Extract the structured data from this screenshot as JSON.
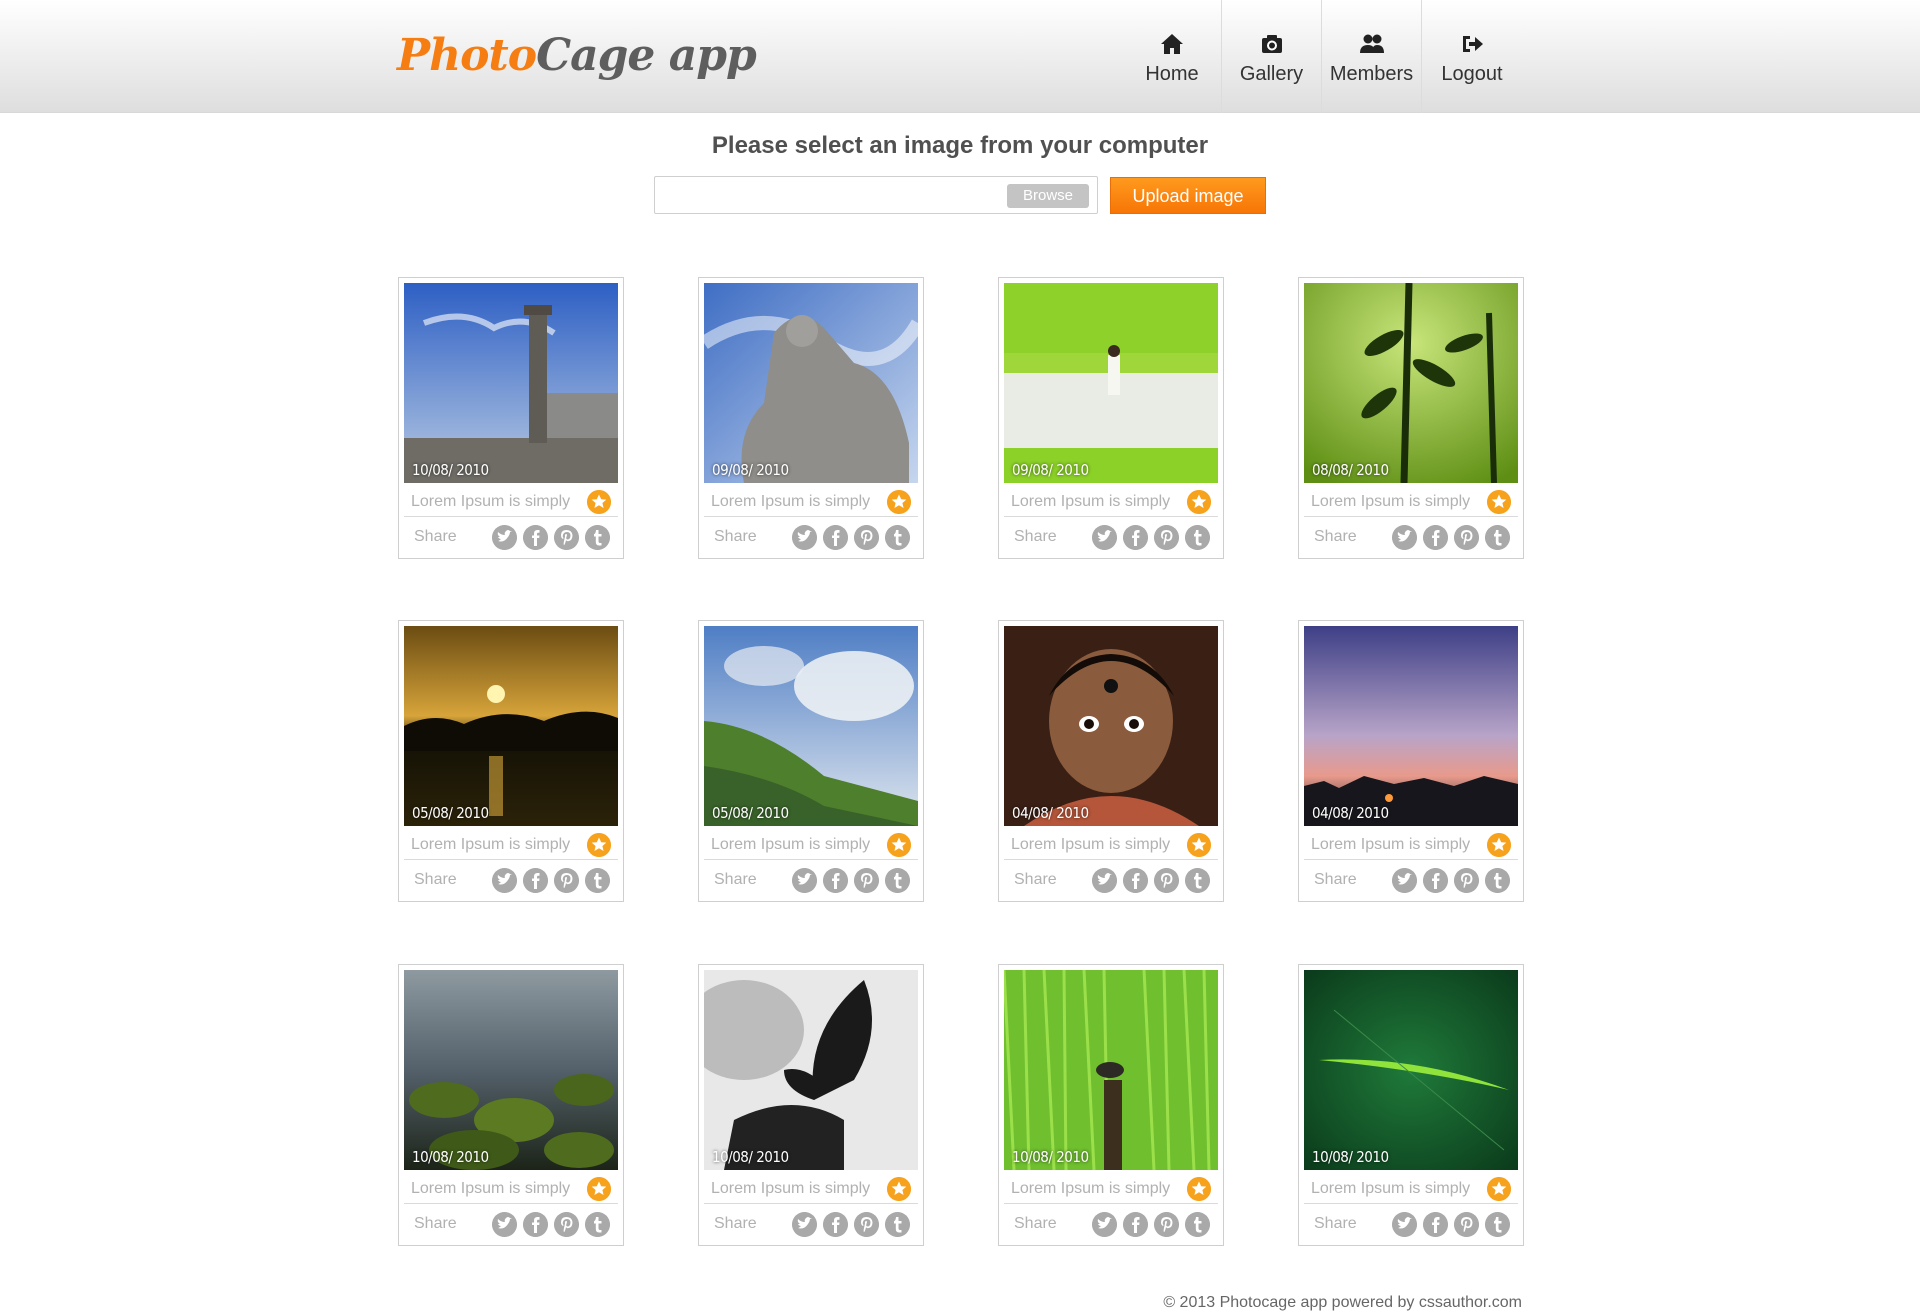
{
  "header": {
    "logo_part1": "Photo",
    "logo_part2": "Cage app",
    "nav": [
      {
        "label": "Home",
        "icon": "home-icon"
      },
      {
        "label": "Gallery",
        "icon": "camera-icon"
      },
      {
        "label": "Members",
        "icon": "users-icon"
      },
      {
        "label": "Logout",
        "icon": "logout-icon"
      }
    ]
  },
  "upload": {
    "title": "Please select an image from your computer",
    "browse_label": "Browse",
    "upload_label": "Upload image"
  },
  "gallery": {
    "share_label": "Share",
    "share_icons": [
      "twitter-icon",
      "facebook-icon",
      "pinterest-icon",
      "tumblr-icon"
    ],
    "star_color": "#f7a21d",
    "items": [
      {
        "date": "10/08/ 2010",
        "caption": "Lorem Ipsum is simply",
        "scene": "pillar"
      },
      {
        "date": "09/08/ 2010",
        "caption": "Lorem Ipsum is simply",
        "scene": "statue"
      },
      {
        "date": "09/08/ 2010",
        "caption": "Lorem Ipsum is simply",
        "scene": "field-girl"
      },
      {
        "date": "08/08/ 2010",
        "caption": "Lorem Ipsum is simply",
        "scene": "plant"
      },
      {
        "date": "05/08/ 2010",
        "caption": "Lorem Ipsum is simply",
        "scene": "sunset"
      },
      {
        "date": "05/08/ 2010",
        "caption": "Lorem Ipsum is simply",
        "scene": "hill"
      },
      {
        "date": "04/08/ 2010",
        "caption": "Lorem Ipsum is simply",
        "scene": "child"
      },
      {
        "date": "04/08/ 2010",
        "caption": "Lorem Ipsum is simply",
        "scene": "dusk"
      },
      {
        "date": "10/08/ 2010",
        "caption": "Lorem Ipsum is simply",
        "scene": "rocks"
      },
      {
        "date": "10/08/ 2010",
        "caption": "Lorem Ipsum is simply",
        "scene": "butterfly"
      },
      {
        "date": "10/08/ 2010",
        "caption": "Lorem Ipsum is simply",
        "scene": "bird"
      },
      {
        "date": "10/08/ 2010",
        "caption": "Lorem Ipsum is simply",
        "scene": "leaf"
      }
    ]
  },
  "footer": {
    "text": "© 2013 Photocage app powered by cssauthor.com"
  }
}
